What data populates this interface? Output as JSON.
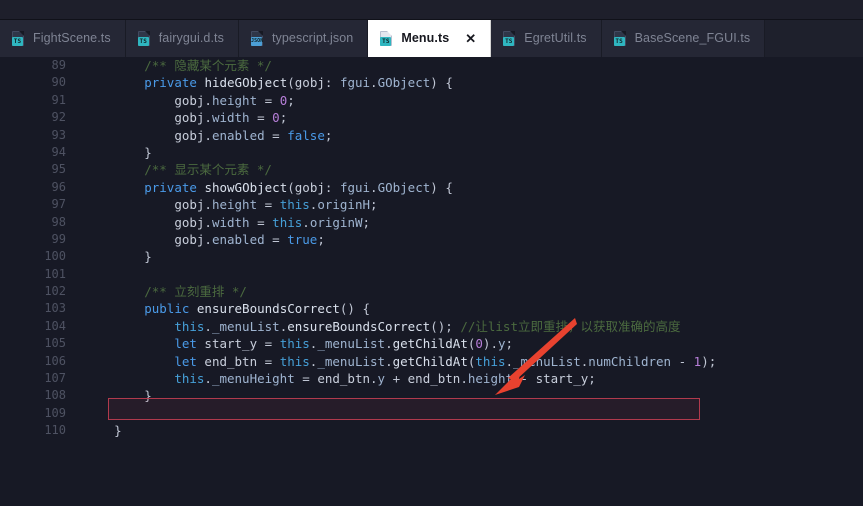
{
  "window": {
    "app": "code-editor",
    "theme_bg": "#171925",
    "tabbar_bg": "#1e202c"
  },
  "tabs": [
    {
      "label": "FightScene.ts",
      "icon": "ts-file-icon",
      "badge": "TS",
      "active": false,
      "closable": false
    },
    {
      "label": "fairygui.d.ts",
      "icon": "ts-file-icon",
      "badge": "TS",
      "active": false,
      "closable": false
    },
    {
      "label": "typescript.json",
      "icon": "json-file-icon",
      "badge": "JSON",
      "active": false,
      "closable": false
    },
    {
      "label": "Menu.ts",
      "icon": "ts-file-icon",
      "badge": "TS",
      "active": true,
      "closable": true,
      "close_label": "✕"
    },
    {
      "label": "EgretUtil.ts",
      "icon": "ts-file-icon",
      "badge": "TS",
      "active": false,
      "closable": false
    },
    {
      "label": "BaseScene_FGUI.ts",
      "icon": "ts-file-icon",
      "badge": "TS",
      "active": false,
      "closable": false
    }
  ],
  "editor": {
    "language": "typescript",
    "first_line": 89,
    "last_line": 110,
    "lines": [
      {
        "n": "89",
        "tokens": [
          {
            "t": "        ",
            "c": "pun"
          },
          {
            "t": "/** 隐藏某个元素 */",
            "c": "cmt"
          }
        ]
      },
      {
        "n": "90",
        "tokens": [
          {
            "t": "        ",
            "c": "pun"
          },
          {
            "t": "private",
            "c": "kw"
          },
          {
            "t": " ",
            "c": "pun"
          },
          {
            "t": "hideGObject",
            "c": "fn"
          },
          {
            "t": "(",
            "c": "pun"
          },
          {
            "t": "gobj",
            "c": "var"
          },
          {
            "t": ": ",
            "c": "pun"
          },
          {
            "t": "fgui",
            "c": "prop"
          },
          {
            "t": ".",
            "c": "pun"
          },
          {
            "t": "GObject",
            "c": "prop"
          },
          {
            "t": ") {",
            "c": "pun"
          }
        ]
      },
      {
        "n": "91",
        "tokens": [
          {
            "t": "            ",
            "c": "pun"
          },
          {
            "t": "gobj",
            "c": "var"
          },
          {
            "t": ".",
            "c": "pun"
          },
          {
            "t": "height",
            "c": "prop"
          },
          {
            "t": " = ",
            "c": "pun"
          },
          {
            "t": "0",
            "c": "num"
          },
          {
            "t": ";",
            "c": "pun"
          }
        ]
      },
      {
        "n": "92",
        "tokens": [
          {
            "t": "            ",
            "c": "pun"
          },
          {
            "t": "gobj",
            "c": "var"
          },
          {
            "t": ".",
            "c": "pun"
          },
          {
            "t": "width",
            "c": "prop"
          },
          {
            "t": " = ",
            "c": "pun"
          },
          {
            "t": "0",
            "c": "num"
          },
          {
            "t": ";",
            "c": "pun"
          }
        ]
      },
      {
        "n": "93",
        "tokens": [
          {
            "t": "            ",
            "c": "pun"
          },
          {
            "t": "gobj",
            "c": "var"
          },
          {
            "t": ".",
            "c": "pun"
          },
          {
            "t": "enabled",
            "c": "prop"
          },
          {
            "t": " = ",
            "c": "pun"
          },
          {
            "t": "false",
            "c": "lit"
          },
          {
            "t": ";",
            "c": "pun"
          }
        ]
      },
      {
        "n": "94",
        "tokens": [
          {
            "t": "        }",
            "c": "pun"
          }
        ]
      },
      {
        "n": "95",
        "tokens": [
          {
            "t": "        ",
            "c": "pun"
          },
          {
            "t": "/** 显示某个元素 */",
            "c": "cmt"
          }
        ]
      },
      {
        "n": "96",
        "tokens": [
          {
            "t": "        ",
            "c": "pun"
          },
          {
            "t": "private",
            "c": "kw"
          },
          {
            "t": " ",
            "c": "pun"
          },
          {
            "t": "showGObject",
            "c": "fn"
          },
          {
            "t": "(",
            "c": "pun"
          },
          {
            "t": "gobj",
            "c": "var"
          },
          {
            "t": ": ",
            "c": "pun"
          },
          {
            "t": "fgui",
            "c": "prop"
          },
          {
            "t": ".",
            "c": "pun"
          },
          {
            "t": "GObject",
            "c": "prop"
          },
          {
            "t": ") {",
            "c": "pun"
          }
        ]
      },
      {
        "n": "97",
        "tokens": [
          {
            "t": "            ",
            "c": "pun"
          },
          {
            "t": "gobj",
            "c": "var"
          },
          {
            "t": ".",
            "c": "pun"
          },
          {
            "t": "height",
            "c": "prop"
          },
          {
            "t": " = ",
            "c": "pun"
          },
          {
            "t": "this",
            "c": "this"
          },
          {
            "t": ".",
            "c": "pun"
          },
          {
            "t": "originH",
            "c": "prop"
          },
          {
            "t": ";",
            "c": "pun"
          }
        ]
      },
      {
        "n": "98",
        "tokens": [
          {
            "t": "            ",
            "c": "pun"
          },
          {
            "t": "gobj",
            "c": "var"
          },
          {
            "t": ".",
            "c": "pun"
          },
          {
            "t": "width",
            "c": "prop"
          },
          {
            "t": " = ",
            "c": "pun"
          },
          {
            "t": "this",
            "c": "this"
          },
          {
            "t": ".",
            "c": "pun"
          },
          {
            "t": "originW",
            "c": "prop"
          },
          {
            "t": ";",
            "c": "pun"
          }
        ]
      },
      {
        "n": "99",
        "tokens": [
          {
            "t": "            ",
            "c": "pun"
          },
          {
            "t": "gobj",
            "c": "var"
          },
          {
            "t": ".",
            "c": "pun"
          },
          {
            "t": "enabled",
            "c": "prop"
          },
          {
            "t": " = ",
            "c": "pun"
          },
          {
            "t": "true",
            "c": "lit"
          },
          {
            "t": ";",
            "c": "pun"
          }
        ]
      },
      {
        "n": "100",
        "tokens": [
          {
            "t": "        }",
            "c": "pun"
          }
        ]
      },
      {
        "n": "101",
        "tokens": [
          {
            "t": "",
            "c": "pun"
          }
        ]
      },
      {
        "n": "102",
        "tokens": [
          {
            "t": "        ",
            "c": "pun"
          },
          {
            "t": "/** 立刻重排 */",
            "c": "cmt"
          }
        ]
      },
      {
        "n": "103",
        "tokens": [
          {
            "t": "        ",
            "c": "pun"
          },
          {
            "t": "public",
            "c": "kw"
          },
          {
            "t": " ",
            "c": "pun"
          },
          {
            "t": "ensureBoundsCorrect",
            "c": "fn"
          },
          {
            "t": "() {",
            "c": "pun"
          }
        ]
      },
      {
        "n": "104",
        "tokens": [
          {
            "t": "            ",
            "c": "pun"
          },
          {
            "t": "this",
            "c": "this"
          },
          {
            "t": ".",
            "c": "pun"
          },
          {
            "t": "_menuList",
            "c": "prop"
          },
          {
            "t": ".",
            "c": "pun"
          },
          {
            "t": "ensureBoundsCorrect",
            "c": "fn"
          },
          {
            "t": "(); ",
            "c": "pun"
          },
          {
            "t": "//让list立即重排，以获取准确的高度",
            "c": "cmt"
          }
        ]
      },
      {
        "n": "105",
        "tokens": [
          {
            "t": "            ",
            "c": "pun"
          },
          {
            "t": "let",
            "c": "kw"
          },
          {
            "t": " ",
            "c": "pun"
          },
          {
            "t": "start_y",
            "c": "var"
          },
          {
            "t": " = ",
            "c": "pun"
          },
          {
            "t": "this",
            "c": "this"
          },
          {
            "t": ".",
            "c": "pun"
          },
          {
            "t": "_menuList",
            "c": "prop"
          },
          {
            "t": ".",
            "c": "pun"
          },
          {
            "t": "getChildAt",
            "c": "fn"
          },
          {
            "t": "(",
            "c": "pun"
          },
          {
            "t": "0",
            "c": "num"
          },
          {
            "t": ").",
            "c": "pun"
          },
          {
            "t": "y",
            "c": "prop"
          },
          {
            "t": ";",
            "c": "pun"
          }
        ]
      },
      {
        "n": "106",
        "tokens": [
          {
            "t": "            ",
            "c": "pun"
          },
          {
            "t": "let",
            "c": "kw"
          },
          {
            "t": " ",
            "c": "pun"
          },
          {
            "t": "end_btn",
            "c": "var"
          },
          {
            "t": " = ",
            "c": "pun"
          },
          {
            "t": "this",
            "c": "this"
          },
          {
            "t": ".",
            "c": "pun"
          },
          {
            "t": "_menuList",
            "c": "prop"
          },
          {
            "t": ".",
            "c": "pun"
          },
          {
            "t": "getChildAt",
            "c": "fn"
          },
          {
            "t": "(",
            "c": "pun"
          },
          {
            "t": "this",
            "c": "this"
          },
          {
            "t": ".",
            "c": "pun"
          },
          {
            "t": "_menuList",
            "c": "prop"
          },
          {
            "t": ".",
            "c": "pun"
          },
          {
            "t": "numChildren",
            "c": "prop"
          },
          {
            "t": " - ",
            "c": "pun"
          },
          {
            "t": "1",
            "c": "num"
          },
          {
            "t": ");",
            "c": "pun"
          }
        ]
      },
      {
        "n": "107",
        "tokens": [
          {
            "t": "            ",
            "c": "pun"
          },
          {
            "t": "this",
            "c": "this"
          },
          {
            "t": ".",
            "c": "pun"
          },
          {
            "t": "_menuHeight",
            "c": "prop"
          },
          {
            "t": " = ",
            "c": "pun"
          },
          {
            "t": "end_btn",
            "c": "var"
          },
          {
            "t": ".",
            "c": "pun"
          },
          {
            "t": "y",
            "c": "prop"
          },
          {
            "t": " + ",
            "c": "pun"
          },
          {
            "t": "end_btn",
            "c": "var"
          },
          {
            "t": ".",
            "c": "pun"
          },
          {
            "t": "height",
            "c": "prop"
          },
          {
            "t": " - ",
            "c": "pun"
          },
          {
            "t": "start_y",
            "c": "var"
          },
          {
            "t": ";",
            "c": "pun"
          }
        ]
      },
      {
        "n": "108",
        "tokens": [
          {
            "t": "        }",
            "c": "pun"
          }
        ]
      },
      {
        "n": "109",
        "tokens": [
          {
            "t": "",
            "c": "pun"
          }
        ]
      },
      {
        "n": "110",
        "tokens": [
          {
            "t": "    }",
            "c": "pun"
          }
        ]
      }
    ]
  },
  "annotations": {
    "highlight_box": {
      "name": "red-highlight-box",
      "color": "#b13a4d",
      "target_line": "104"
    },
    "arrow": {
      "name": "red-arrow",
      "color": "#e8422f",
      "points_to_line": "104"
    }
  }
}
